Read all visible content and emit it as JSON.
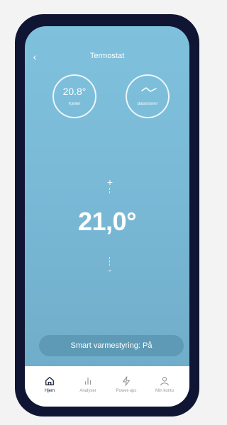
{
  "header": {
    "title": "Termostat",
    "back_icon": "chevron-left-icon"
  },
  "temperature": {
    "value": "20.8°",
    "location": "Kjeller"
  },
  "balance": {
    "icon": "wave-icon",
    "label": "Balanserer"
  },
  "setpoint": {
    "value": "21,0°",
    "increase_label": "+",
    "decrease_label": "-"
  },
  "smart_heating": {
    "label": "Smart varmestyring: På"
  },
  "tabs": [
    {
      "label": "Hjem",
      "icon": "home-icon",
      "active": true
    },
    {
      "label": "Analyser",
      "icon": "bar-chart-icon",
      "active": false
    },
    {
      "label": "Power-ups",
      "icon": "lightning-icon",
      "active": false
    },
    {
      "label": "Min konto",
      "icon": "user-icon",
      "active": false
    }
  ],
  "colors": {
    "background_top": "#7fc1dd",
    "background_bottom": "#6eaac6",
    "frame": "#0f1533",
    "button": "#5e9ab5"
  }
}
